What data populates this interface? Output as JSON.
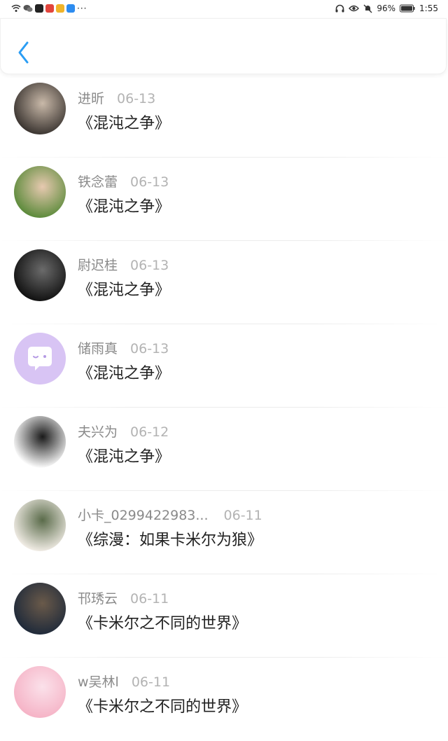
{
  "status_bar": {
    "battery": "96%",
    "time": "1:55"
  },
  "header": {
    "back_icon": "chevron-left-icon",
    "accent": "#2a9df4"
  },
  "items": [
    {
      "name": "进昕",
      "date": "06-13",
      "title": "《混沌之争》",
      "avatar_colors": [
        "#3a3430",
        "#c9b9a9"
      ]
    },
    {
      "name": "铁念蕾",
      "date": "06-13",
      "title": "《混沌之争》",
      "avatar_colors": [
        "#5b8a3a",
        "#e7c9b0"
      ]
    },
    {
      "name": "尉迟桂",
      "date": "06-13",
      "title": "《混沌之争》",
      "avatar_colors": [
        "#111111",
        "#6b6b6b"
      ]
    },
    {
      "name": "储雨真",
      "date": "06-13",
      "title": "《混沌之争》",
      "avatar_colors": [
        "#d8c4f4",
        "#ffffff"
      ]
    },
    {
      "name": "夫兴为",
      "date": "06-12",
      "title": "《混沌之争》",
      "avatar_colors": [
        "#ffffff",
        "#1a1a1a"
      ]
    },
    {
      "name": "小卡_0299422983...",
      "date": "06-11",
      "title": "《综漫：如果卡米尔为狼》",
      "avatar_colors": [
        "#f2ede6",
        "#5a6b4a"
      ]
    },
    {
      "name": "邗琇云",
      "date": "06-11",
      "title": "《卡米尔之不同的世界》",
      "avatar_colors": [
        "#1f2a3a",
        "#6a5a4a"
      ]
    },
    {
      "name": "w吴林l",
      "date": "06-11",
      "title": "《卡米尔之不同的世界》",
      "avatar_colors": [
        "#f5b3c6",
        "#fbe1ea"
      ]
    }
  ]
}
